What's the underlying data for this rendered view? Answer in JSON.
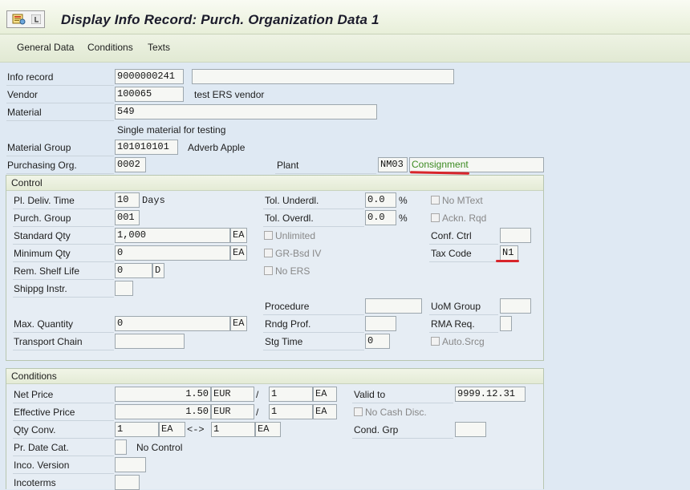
{
  "title": "Display Info Record: Purch. Organization Data 1",
  "tabs": [
    "General Data",
    "Conditions",
    "Texts"
  ],
  "header": {
    "info_record_label": "Info record",
    "info_record_value": "9000000241",
    "vendor_label": "Vendor",
    "vendor_value": "100065",
    "vendor_name": "test ERS vendor",
    "material_label": "Material",
    "material_value": "549",
    "material_desc": "Single material for testing",
    "material_group_label": "Material Group",
    "material_group_value": "101010101",
    "material_group_desc": "Adverb Apple",
    "purch_org_label": "Purchasing Org.",
    "purch_org_value": "0002",
    "plant_label": "Plant",
    "plant_value": "NM03",
    "plant_desc": "Consignment"
  },
  "control": {
    "title": "Control",
    "pl_deliv_time_label": "Pl. Deliv. Time",
    "pl_deliv_time_value": "10",
    "pl_deliv_time_unit": "Days",
    "purch_group_label": "Purch. Group",
    "purch_group_value": "001",
    "standard_qty_label": "Standard Qty",
    "standard_qty_value": "1,000",
    "standard_qty_unit": "EA",
    "minimum_qty_label": "Minimum Qty",
    "minimum_qty_value": "0",
    "minimum_qty_unit": "EA",
    "rem_shelf_life_label": "Rem. Shelf Life",
    "rem_shelf_life_value": "0",
    "rem_shelf_life_unit": "D",
    "shippg_instr_label": "Shippg Instr.",
    "max_quantity_label": "Max. Quantity",
    "max_quantity_value": "0",
    "max_quantity_unit": "EA",
    "transport_chain_label": "Transport Chain",
    "tol_underdl_label": "Tol. Underdl.",
    "tol_underdl_value": "0.0",
    "tol_overdl_label": "Tol. Overdl.",
    "tol_overdl_value": "0.0",
    "percent": "%",
    "unlimited_label": "Unlimited",
    "gr_bsd_iv_label": "GR-Bsd IV",
    "no_ers_label": "No ERS",
    "procedure_label": "Procedure",
    "rndg_prof_label": "Rndg Prof.",
    "stg_time_label": "Stg Time",
    "stg_time_value": "0",
    "no_mtext_label": "No MText",
    "ackn_rqd_label": "Ackn. Rqd",
    "conf_ctrl_label": "Conf. Ctrl",
    "tax_code_label": "Tax Code",
    "tax_code_value": "N1",
    "uom_group_label": "UoM Group",
    "rma_req_label": "RMA Req.",
    "auto_srcg_label": "Auto.Srcg"
  },
  "conditions": {
    "title": "Conditions",
    "net_price_label": "Net Price",
    "net_price_value": "1.50",
    "net_price_currency": "EUR",
    "net_price_per": "1",
    "net_price_unit": "EA",
    "effective_price_label": "Effective Price",
    "effective_price_value": "1.50",
    "effective_price_currency": "EUR",
    "effective_price_per": "1",
    "effective_price_unit": "EA",
    "slash": "/",
    "qty_conv_label": "Qty Conv.",
    "qty_conv_from": "1",
    "qty_conv_from_unit": "EA",
    "qty_conv_arrow": "<->",
    "qty_conv_to": "1",
    "qty_conv_to_unit": "EA",
    "pr_date_cat_label": "Pr. Date Cat.",
    "pr_date_cat_desc": "No Control",
    "inco_version_label": "Inco. Version",
    "incoterms_label": "Incoterms",
    "valid_to_label": "Valid to",
    "valid_to_value": "9999.12.31",
    "no_cash_disc_label": "No Cash Disc.",
    "cond_grp_label": "Cond. Grp"
  }
}
